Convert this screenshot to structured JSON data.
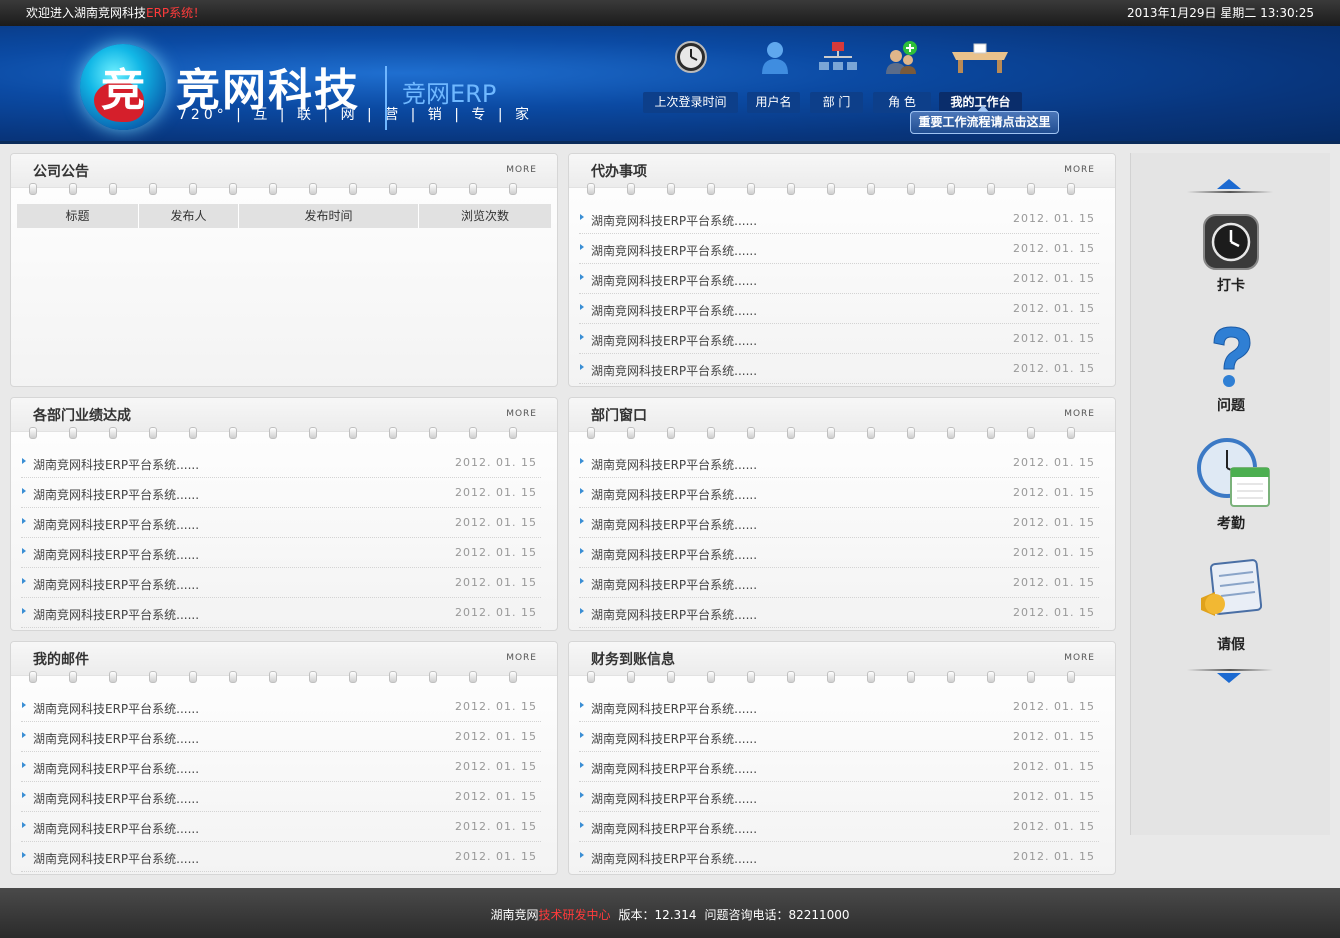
{
  "topbar": {
    "welcome_prefix": "欢迎进入湖南竞网科技",
    "welcome_highlight": "ERP系统！",
    "datetime": "2013年1月29日 星期二  13:30:25"
  },
  "header": {
    "brand": "竞网科技",
    "slogan": "720° | 互 | 联 | 网 | 营 | 销 | 专 | 家",
    "product": "竞网ERP",
    "nav": [
      {
        "label": "上次登录时间",
        "icon": "clock-icon"
      },
      {
        "label": "用户名",
        "icon": "user-icon"
      },
      {
        "label": "部 门",
        "icon": "org-chart-icon"
      },
      {
        "label": "角 色",
        "icon": "role-add-icon"
      },
      {
        "label": "我的工作台",
        "icon": "desk-icon"
      }
    ],
    "tooltip": "重要工作流程请点击这里"
  },
  "panels": {
    "more_label": "MORE",
    "announcements": {
      "title": "公司公告",
      "columns": [
        "标题",
        "发布人",
        "发布时间",
        "浏览次数"
      ]
    },
    "todo": {
      "title": "代办事项",
      "items": [
        {
          "text": "湖南竞网科技ERP平台系统......",
          "date": "2012. 01. 15"
        },
        {
          "text": "湖南竞网科技ERP平台系统......",
          "date": "2012. 01. 15"
        },
        {
          "text": "湖南竞网科技ERP平台系统......",
          "date": "2012. 01. 15"
        },
        {
          "text": "湖南竞网科技ERP平台系统......",
          "date": "2012. 01. 15"
        },
        {
          "text": "湖南竞网科技ERP平台系统......",
          "date": "2012. 01. 15"
        },
        {
          "text": "湖南竞网科技ERP平台系统......",
          "date": "2012. 01. 15"
        }
      ]
    },
    "performance": {
      "title": "各部门业绩达成",
      "items": [
        {
          "text": "湖南竞网科技ERP平台系统......",
          "date": "2012. 01. 15"
        },
        {
          "text": "湖南竞网科技ERP平台系统......",
          "date": "2012. 01. 15"
        },
        {
          "text": "湖南竞网科技ERP平台系统......",
          "date": "2012. 01. 15"
        },
        {
          "text": "湖南竞网科技ERP平台系统......",
          "date": "2012. 01. 15"
        },
        {
          "text": "湖南竞网科技ERP平台系统......",
          "date": "2012. 01. 15"
        },
        {
          "text": "湖南竞网科技ERP平台系统......",
          "date": "2012. 01. 15"
        }
      ]
    },
    "dept_window": {
      "title": "部门窗口",
      "items": [
        {
          "text": "湖南竞网科技ERP平台系统......",
          "date": "2012. 01. 15"
        },
        {
          "text": "湖南竞网科技ERP平台系统......",
          "date": "2012. 01. 15"
        },
        {
          "text": "湖南竞网科技ERP平台系统......",
          "date": "2012. 01. 15"
        },
        {
          "text": "湖南竞网科技ERP平台系统......",
          "date": "2012. 01. 15"
        },
        {
          "text": "湖南竞网科技ERP平台系统......",
          "date": "2012. 01. 15"
        },
        {
          "text": "湖南竞网科技ERP平台系统......",
          "date": "2012. 01. 15"
        }
      ]
    },
    "mail": {
      "title": "我的邮件",
      "items": [
        {
          "text": "湖南竞网科技ERP平台系统......",
          "date": "2012. 01. 15"
        },
        {
          "text": "湖南竞网科技ERP平台系统......",
          "date": "2012. 01. 15"
        },
        {
          "text": "湖南竞网科技ERP平台系统......",
          "date": "2012. 01. 15"
        },
        {
          "text": "湖南竞网科技ERP平台系统......",
          "date": "2012. 01. 15"
        },
        {
          "text": "湖南竞网科技ERP平台系统......",
          "date": "2012. 01. 15"
        },
        {
          "text": "湖南竞网科技ERP平台系统......",
          "date": "2012. 01. 15"
        }
      ]
    },
    "finance": {
      "title": "财务到账信息",
      "items": [
        {
          "text": "湖南竞网科技ERP平台系统......",
          "date": "2012. 01. 15"
        },
        {
          "text": "湖南竞网科技ERP平台系统......",
          "date": "2012. 01. 15"
        },
        {
          "text": "湖南竞网科技ERP平台系统......",
          "date": "2012. 01. 15"
        },
        {
          "text": "湖南竞网科技ERP平台系统......",
          "date": "2012. 01. 15"
        },
        {
          "text": "湖南竞网科技ERP平台系统......",
          "date": "2012. 01. 15"
        },
        {
          "text": "湖南竞网科技ERP平台系统......",
          "date": "2012. 01. 15"
        }
      ]
    }
  },
  "sidebar": {
    "items": [
      {
        "label": "打卡",
        "icon": "time-machine-icon"
      },
      {
        "label": "问题",
        "icon": "question-icon"
      },
      {
        "label": "考勤",
        "icon": "clock-calendar-icon"
      },
      {
        "label": "请假",
        "icon": "notice-calendar-icon"
      }
    ]
  },
  "footer": {
    "org": "湖南竞网",
    "center": "技术研发中心",
    "version": "版本：12.314",
    "phone": "问题咨询电话：82211000"
  },
  "colors": {
    "header_blue": "#0b4aa3",
    "accent_blue": "#1c6ad1",
    "highlight_red": "#ff3b3b"
  }
}
